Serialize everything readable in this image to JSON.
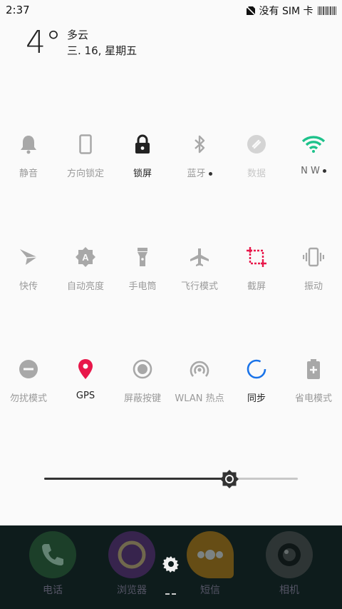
{
  "status_bar": {
    "time": "2:37",
    "carrier": "没有 SIM 卡"
  },
  "weather": {
    "temperature": "4°",
    "condition": "多云",
    "date": "三. 16, 星期五"
  },
  "tiles": {
    "mute": "静音",
    "rotation_lock": "方向锁定",
    "lock_screen": "锁屏",
    "bluetooth": "蓝牙",
    "data": "数据",
    "wlan": "N W",
    "quick_share": "快传",
    "auto_brightness": "自动亮度",
    "flashlight": "手电筒",
    "airplane": "飞行模式",
    "screenshot": "截屏",
    "vibrate": "振动",
    "dnd": "勿扰模式",
    "gps": "GPS",
    "block_keys": "屏蔽按键",
    "hotspot": "WLAN 热点",
    "sync": "同步",
    "power_saving": "省电模式"
  },
  "brightness": {
    "level": 0.73
  },
  "dock": {
    "phone": "电话",
    "browser": "浏览器",
    "sms": "短信",
    "camera": "相机"
  },
  "colors": {
    "accent_red": "#e8174a",
    "gps_red": "#e8174a",
    "wifi_green": "#1ec28b",
    "sync_blue": "#1a73e8"
  },
  "icons": [
    "bell-icon",
    "phone-rotation-icon",
    "lock-icon",
    "bluetooth-icon",
    "data-icon",
    "wifi-icon",
    "paper-plane-icon",
    "brightness-auto-icon",
    "flashlight-icon",
    "airplane-icon",
    "crop-icon",
    "vibrate-icon",
    "minus-circle-icon",
    "location-pin-icon",
    "radio-button-icon",
    "hotspot-icon",
    "sync-icon",
    "battery-plus-icon",
    "gear-icon"
  ]
}
